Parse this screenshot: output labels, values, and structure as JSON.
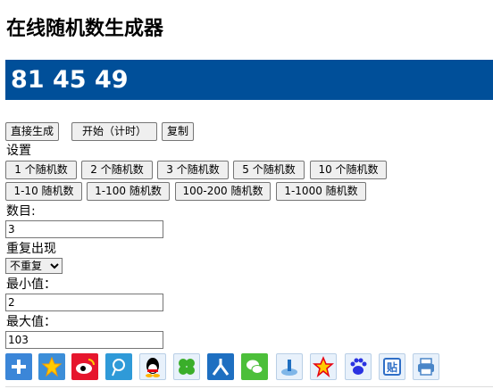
{
  "title": "在线随机数生成器",
  "result": "81 45 49",
  "actions": {
    "generate": "直接生成",
    "start": "开始（计时）",
    "copy": "复制"
  },
  "settings_label": "设置",
  "presets_row1": [
    "1 个随机数",
    "2 个随机数",
    "3 个随机数",
    "5 个随机数",
    "10 个随机数"
  ],
  "presets_row2": [
    "1-10 随机数",
    "1-100 随机数",
    "100-200 随机数",
    "1-1000 随机数"
  ],
  "count": {
    "label": "数目:",
    "value": "3"
  },
  "repeat": {
    "label": "重复出现",
    "selected": "不重复"
  },
  "min": {
    "label": "最小值：",
    "value": "2"
  },
  "max": {
    "label": "最大值：",
    "value": "103"
  },
  "share_icons": [
    "plus-icon",
    "qzone-icon",
    "weibo-icon",
    "tencent-weibo-icon",
    "qq-icon",
    "clover-icon",
    "renren-icon",
    "wechat-icon",
    "upload-icon",
    "star-icon",
    "baidu-icon",
    "tieba-icon",
    "print-icon"
  ]
}
